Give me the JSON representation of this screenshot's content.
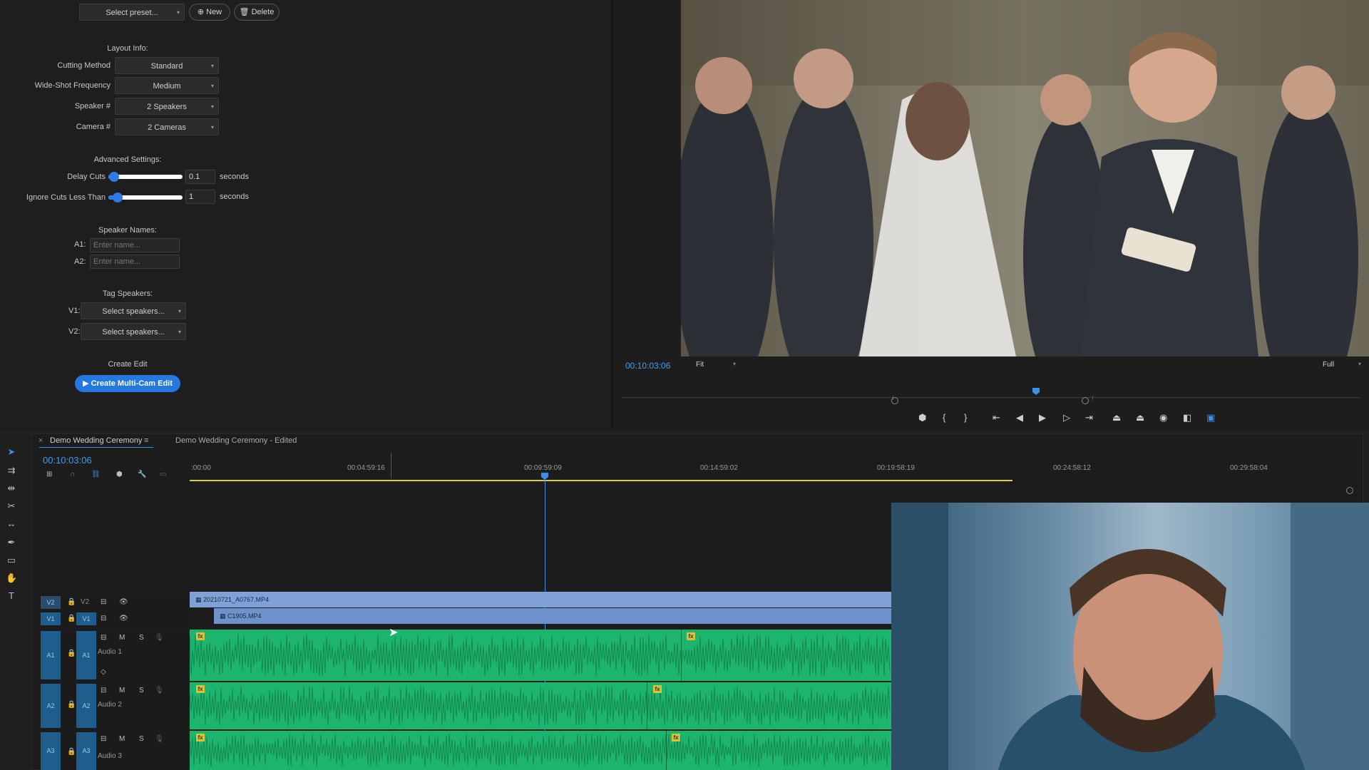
{
  "plugin": {
    "preset": "Select preset...",
    "new_label": "New",
    "delete_label": "Delete",
    "layout_title": "Layout Info:",
    "cutting_method_label": "Cutting Method",
    "cutting_method_value": "Standard",
    "wide_shot_label": "Wide-Shot Frequency",
    "wide_shot_value": "Medium",
    "speaker_label": "Speaker #",
    "speaker_value": "2 Speakers",
    "camera_label": "Camera #",
    "camera_value": "2 Cameras",
    "advanced_title": "Advanced Settings:",
    "delay_label": "Delay Cuts",
    "delay_value": "0.1",
    "delay_fraction": 0.05,
    "ignore_label": "Ignore Cuts Less Than",
    "ignore_value": "1",
    "ignore_fraction": 0.1,
    "seconds": "seconds",
    "speaker_names_title": "Speaker Names:",
    "a1_label": "A1:",
    "a2_label": "A2:",
    "name_placeholder": "Enter name...",
    "tag_title": "Tag Speakers:",
    "v1_label": "V1:",
    "v2_label": "V2:",
    "select_speakers": "Select speakers...",
    "create_title": "Create Edit",
    "create_button": "Create Multi-Cam Edit"
  },
  "monitor": {
    "timecode": "00:10:03:06",
    "fit": "Fit",
    "quality": "Full"
  },
  "timeline": {
    "tab_active": "Demo Wedding Ceremony",
    "tab_other": "Demo Wedding Ceremony - Edited",
    "timecode": "00:10:03:06",
    "ruler": [
      ":00:00",
      "00:04:59:16",
      "00:09:59:09",
      "00:14:59:02",
      "00:19:58:19",
      "00:24:58:12",
      "00:29:58:04"
    ],
    "v2_label": "V2",
    "v1_label": "V1",
    "a1_label": "A1",
    "a2_label": "A2",
    "a3_label": "A3",
    "audio1_name": "Audio 1",
    "audio2_name": "Audio 2",
    "audio3_name": "Audio 3",
    "m_label": "M",
    "s_label": "S",
    "clip_v2": "20210721_A0767.MP4",
    "clip_v1": "C1905.MP4",
    "fx_label": "fx"
  }
}
